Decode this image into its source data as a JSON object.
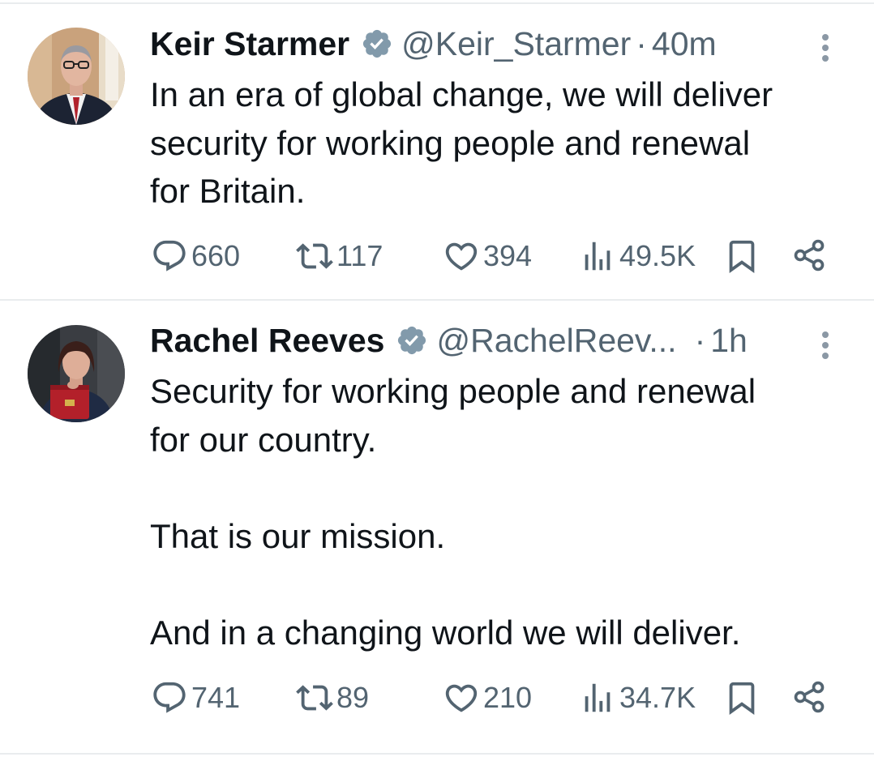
{
  "tweets": [
    {
      "author": "Keir Starmer",
      "handle": "@Keir_Starmer",
      "separator": "·",
      "time": "40m",
      "text": "In an era of global change, we will deliver\nsecurity for working people and renewal\nfor Britain.",
      "counts": {
        "replies": "660",
        "reposts": "117",
        "likes": "394",
        "views": "49.5K"
      }
    },
    {
      "author": "Rachel Reeves",
      "handle": "@RachelReev...",
      "separator": "·",
      "time": "1h",
      "text": "Security for working people and renewal\nfor our country.\n\nThat is our mission.\n\nAnd in a changing world we will deliver.",
      "counts": {
        "replies": "741",
        "reposts": "89",
        "likes": "210",
        "views": "34.7K"
      }
    }
  ],
  "icons": {
    "verified": "verified-badge-icon",
    "more": "more-vertical-icon",
    "reply": "reply-icon",
    "repost": "repost-icon",
    "like": "heart-icon",
    "views": "views-icon",
    "bookmark": "bookmark-icon",
    "share": "share-icon"
  },
  "colors": {
    "text": "#0f1419",
    "secondary": "#536471",
    "verified": "#829aab",
    "divider": "#e9ecee"
  }
}
